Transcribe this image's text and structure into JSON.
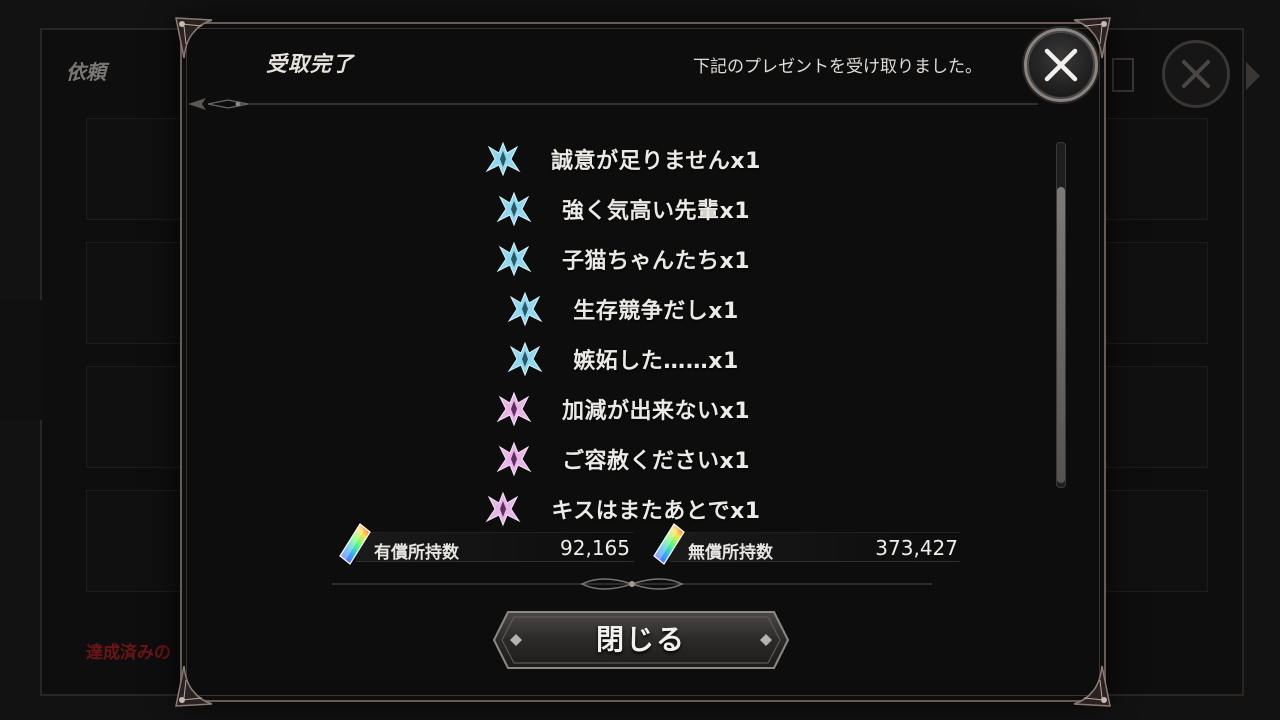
{
  "background": {
    "title": "依頼",
    "footer_notice": "達成済みの"
  },
  "dialog": {
    "title": "受取完了",
    "subtitle": "下記のプレゼントを受け取りました。",
    "close_icon": "close-x-icon"
  },
  "rewards": [
    {
      "label": "誠意が足りませんx1",
      "icon": "crest-icon",
      "color": "#8fd8ee"
    },
    {
      "label": "強く気高い先輩x1",
      "icon": "crest-icon",
      "color": "#8fd8ee"
    },
    {
      "label": "子猫ちゃんたちx1",
      "icon": "crest-icon",
      "color": "#8fd8ee"
    },
    {
      "label": "生存競争だしx1",
      "icon": "crest-icon",
      "color": "#8fd8ee"
    },
    {
      "label": "嫉妬した……x1",
      "icon": "crest-icon",
      "color": "#8fd8ee"
    },
    {
      "label": "加減が出来ないx1",
      "icon": "crest-icon",
      "color": "#e7b5e6"
    },
    {
      "label": "ご容赦くださいx1",
      "icon": "crest-icon",
      "color": "#e7b5e6"
    },
    {
      "label": "キスはまたあとでx1",
      "icon": "crest-icon",
      "color": "#e7b5e6"
    }
  ],
  "currency": {
    "paid": {
      "label": "有償所持数",
      "value": "92,165",
      "icon": "rainbow-crystal-icon"
    },
    "free": {
      "label": "無償所持数",
      "value": "373,427",
      "icon": "rainbow-crystal-icon"
    }
  },
  "buttons": {
    "close_label": "閉じる"
  },
  "colors": {
    "frame": "#6a5a55",
    "crest_blue": "#8fd8ee",
    "crest_pink": "#e7b5e6"
  }
}
